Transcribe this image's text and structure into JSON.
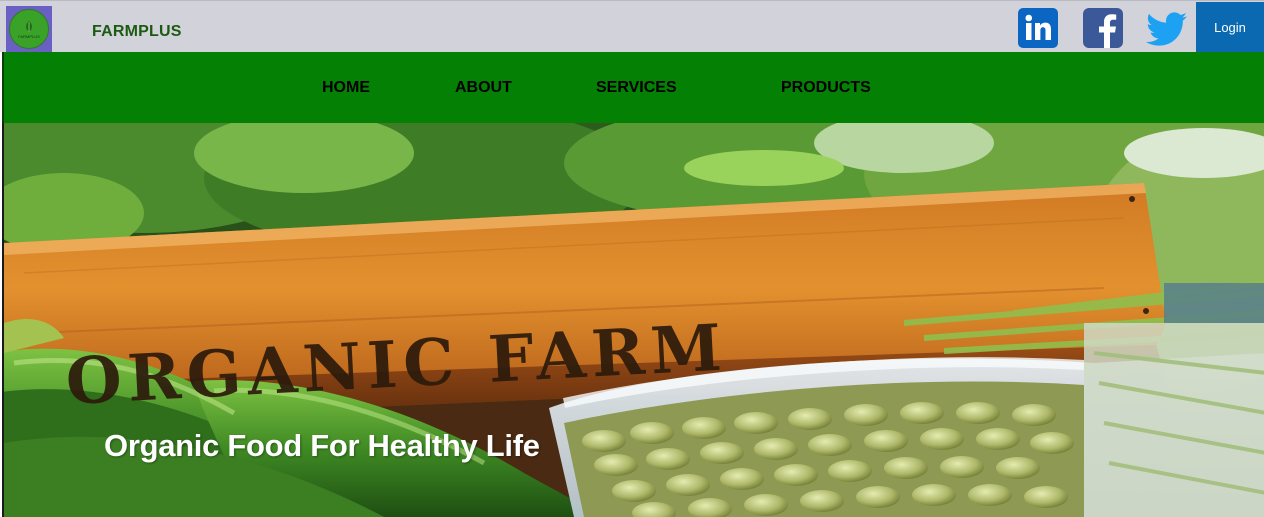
{
  "header": {
    "brand": "FARMPLUS",
    "logo_text": "FARMPLUS",
    "login_label": "Login",
    "social": [
      {
        "name": "linkedin-icon",
        "color": "#0a66c2"
      },
      {
        "name": "facebook-icon",
        "color": "#3b5998"
      },
      {
        "name": "twitter-icon",
        "color": "#1da1f2"
      }
    ]
  },
  "nav": {
    "items": [
      "HOME",
      "ABOUT",
      "SERVICES",
      "PRODUCTS"
    ],
    "background": "#048004"
  },
  "hero": {
    "sign_text": "ORGANIC FARM",
    "title": "Organic Food For Healthy Life"
  },
  "colors": {
    "topbar": "#d2d2da",
    "login_button": "#0a69b0",
    "brand_text": "#1c5a12"
  }
}
